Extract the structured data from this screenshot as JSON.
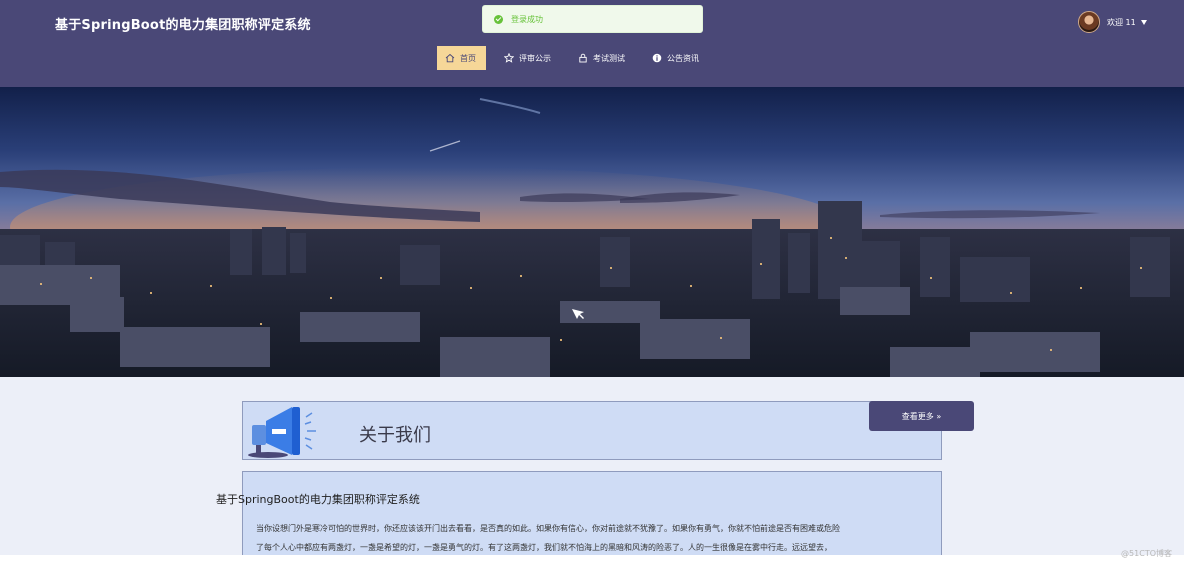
{
  "header": {
    "site_title": "基于SpringBoot的电力集团职称评定系统",
    "toast_text": "登录成功",
    "welcome_text": "欢迎 11"
  },
  "nav": {
    "items": [
      {
        "label": "首页",
        "icon": "home-icon",
        "active": true
      },
      {
        "label": "评审公示",
        "icon": "star-icon",
        "active": false
      },
      {
        "label": "考试测试",
        "icon": "lock-icon",
        "active": false
      },
      {
        "label": "公告资讯",
        "icon": "info-icon",
        "active": false
      }
    ]
  },
  "about": {
    "title": "关于我们",
    "more_label": "查看更多 »",
    "subtitle": "基于SpringBoot的电力集团职称评定系统",
    "paragraph_line1": "当你设想门外是寒冷可怕的世界时，你还应该该开门出去看看，是否真的如此。如果你有信心，你对前途就不犹豫了。如果你有勇气，你就不怕前途是否有困难或危险",
    "paragraph_line2": "了每个人心中都应有两盏灯，一盏是希望的灯，一盏是勇气的灯。有了这两盏灯，我们就不怕海上的黑暗和风涛的险恶了。人的一生很像是在雾中行走。远远望去，"
  },
  "watermark": "@51CTO博客",
  "colors": {
    "header_bg": "#4a4877",
    "nav_active_bg": "#f6d798",
    "toast_text": "#67c23a",
    "panel_bg": "#cfdcf5"
  }
}
